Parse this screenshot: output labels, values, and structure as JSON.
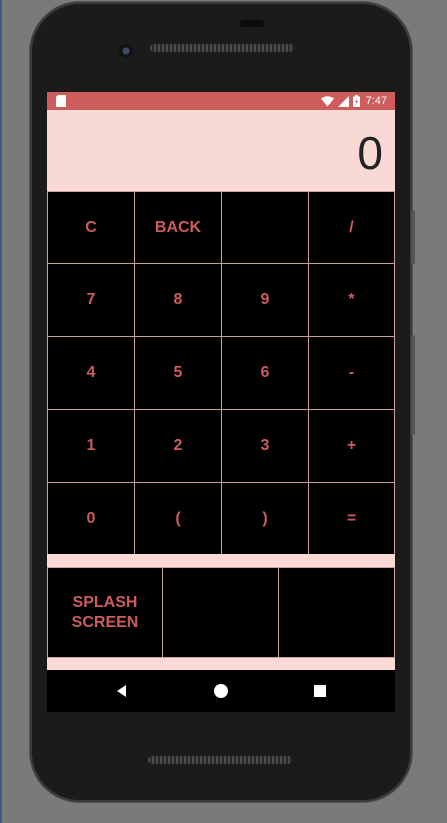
{
  "status_bar": {
    "time": "7:47",
    "color": "#cd5c5c"
  },
  "display": {
    "value": "0"
  },
  "keypad": {
    "rows": [
      [
        "C",
        "BACK",
        "",
        "/"
      ],
      [
        "7",
        "8",
        "9",
        "*"
      ],
      [
        "4",
        "5",
        "6",
        "-"
      ],
      [
        "1",
        "2",
        "3",
        "+"
      ],
      [
        "0",
        "(",
        ")",
        "="
      ]
    ]
  },
  "extra_buttons": [
    "SPLASH\nSCREEN",
    "",
    ""
  ],
  "nav": {
    "icons": [
      "back-icon",
      "home-icon",
      "recents-icon"
    ]
  },
  "colors": {
    "accent": "#cd5c5c",
    "display_bg": "#f9d9d3",
    "grid_line": "#c9a39b"
  }
}
